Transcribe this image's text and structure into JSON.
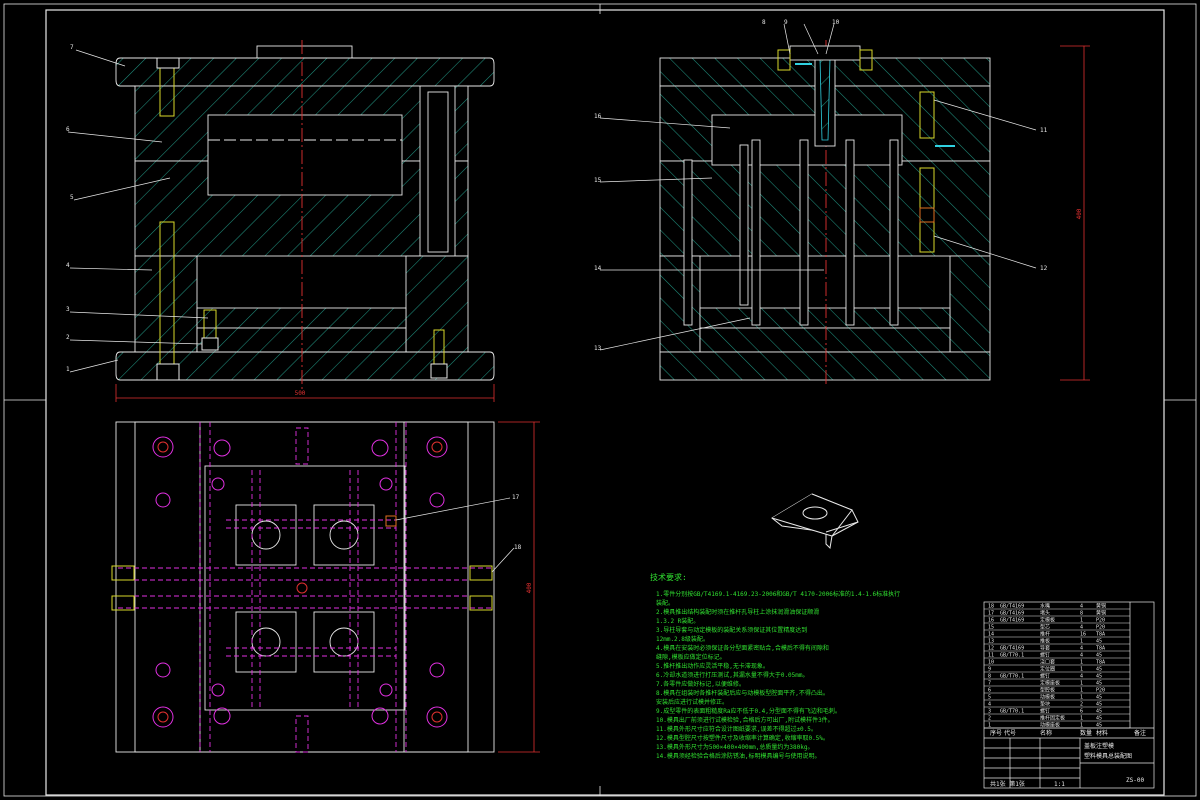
{
  "drawing": {
    "callouts_front": [
      "7",
      "6",
      "5",
      "4",
      "3",
      "2",
      "1"
    ],
    "callouts_top": [
      "8",
      "9",
      "10"
    ],
    "callouts_side_left": [
      "16",
      "15",
      "14",
      "13"
    ],
    "callouts_side_right": [
      "11",
      "12"
    ],
    "callouts_plan": [
      "17",
      "18"
    ],
    "dimension_front": "500",
    "dimension_side": "400",
    "dimension_plan": "400"
  },
  "tech_notes": {
    "title": "技术要求:",
    "lines": [
      "1.零件分别按GB/T4169.1-4169.23-2006和GB/T 4170-2006标准的1.4-1.6标准执行",
      "装配。",
      "2.模具推出结构装配时须在推杆孔导柱上涂抹润滑油保证顺滑",
      "1.3.2 R装配。",
      "3.导柱导套与动定模板的装配关系须保证其位置精度达到",
      "12mm.2.8级装配。",
      "4.模具在安装时必须保证各分型面紧密贴合,合模后不得有间隙和",
      "缝隙,模板应做定位标记。",
      "5.推杆推出动作应灵活平稳,无卡滞现象。",
      "6.冷却水道须进行打压测试,其漏水量不得大于0.05mm。",
      "7.各零件应做好标记,以便维修。",
      "8.模具在组装时各推杆装配后应与动模板型腔面平齐,不得凸出。",
      "  安装后应进行试模并修正。",
      "9.成型零件的表面粗糙度Ra应不低于0.4,分型面不得有飞边和毛刺。",
      "10.模具出厂前须进行试模检验,合格后方可出厂,附试模样件3件。",
      "11.模具外形尺寸应符合设计图纸要求,误差不得超过±0.5。",
      "12.模具型腔尺寸按塑件尺寸及收缩率计算确定,收缩率取0.5%。",
      "13.模具外形尺寸为500×400×400mm,总质量约为380kg。",
      "14.模具须经检验合格后涂防锈油,标明模具编号与使用说明。"
    ]
  },
  "title_block": {
    "part_name": "塑料模具总装配图",
    "part_sub": "盖板注塑模",
    "drawing_no": "ZS-00",
    "scale": "1:1",
    "sheet": "共1张 第1张",
    "bom_rows": [
      [
        "18",
        "GB/T4169",
        "水嘴",
        "4",
        "黄铜",
        ""
      ],
      [
        "17",
        "GB/T4169",
        "堵头",
        "8",
        "黄铜",
        ""
      ],
      [
        "16",
        "GB/T4169",
        "定模板",
        "1",
        "P20",
        ""
      ],
      [
        "15",
        "",
        "型芯",
        "4",
        "P20",
        ""
      ],
      [
        "14",
        "",
        "推杆",
        "16",
        "T8A",
        ""
      ],
      [
        "13",
        "",
        "推板",
        "1",
        "45",
        ""
      ],
      [
        "12",
        "GB/T4169",
        "导套",
        "4",
        "T8A",
        ""
      ],
      [
        "11",
        "GB/T70.1",
        "螺钉",
        "4",
        "45",
        ""
      ],
      [
        "10",
        "",
        "浇口套",
        "1",
        "T8A",
        ""
      ],
      [
        "9",
        "",
        "定位圈",
        "1",
        "45",
        ""
      ],
      [
        "8",
        "GB/T70.1",
        "螺钉",
        "4",
        "45",
        ""
      ],
      [
        "7",
        "",
        "定模座板",
        "1",
        "45",
        ""
      ],
      [
        "6",
        "",
        "型腔板",
        "1",
        "P20",
        ""
      ],
      [
        "5",
        "",
        "动模板",
        "1",
        "45",
        ""
      ],
      [
        "4",
        "",
        "垫块",
        "2",
        "45",
        ""
      ],
      [
        "3",
        "GB/T70.1",
        "螺钉",
        "6",
        "45",
        ""
      ],
      [
        "2",
        "",
        "推杆固定板",
        "1",
        "45",
        ""
      ],
      [
        "1",
        "",
        "动模座板",
        "1",
        "45",
        ""
      ]
    ],
    "header": [
      "序号",
      "代号",
      "名称",
      "数量",
      "材料",
      "备注"
    ]
  },
  "colors": {
    "line": "#e8e8e8",
    "hatch": "#1f8f7d",
    "bolt": "#d8d82a",
    "magenta": "#e030e0",
    "red": "#e03030",
    "cyan": "#30d0e0",
    "green": "#30e030",
    "orange": "#e07020"
  }
}
